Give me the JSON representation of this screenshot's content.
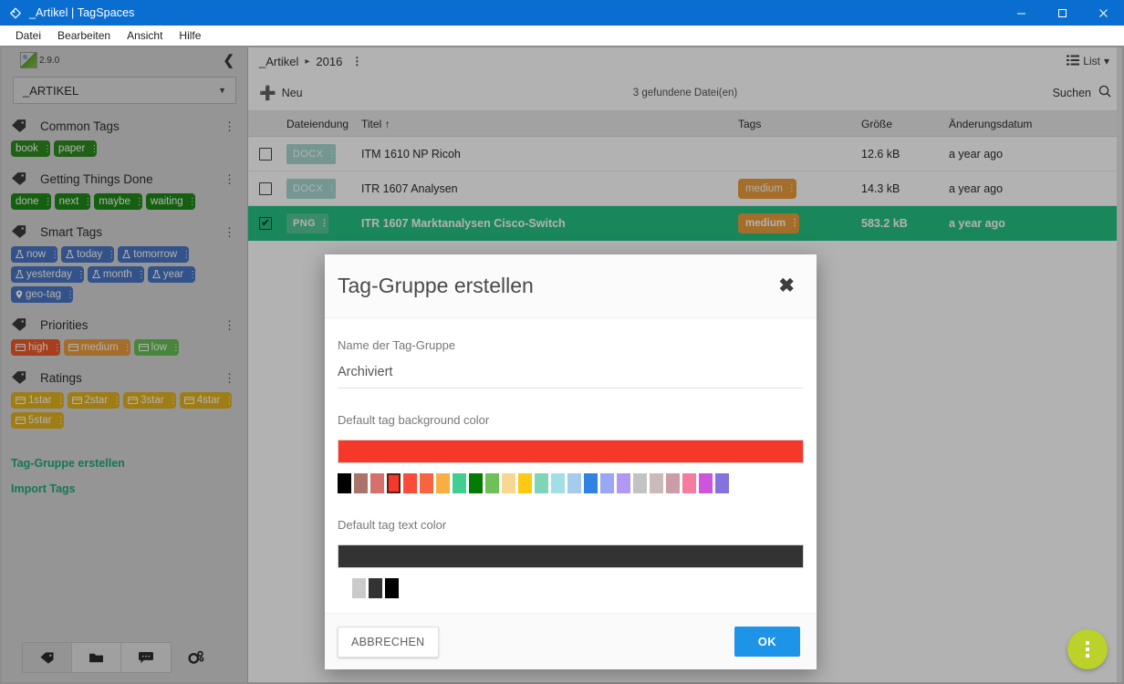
{
  "window": {
    "title": "_Artikel | TagSpaces",
    "app_icon": "tagspaces-icon",
    "controls": {
      "minimize": "minimize-icon",
      "maximize": "maximize-icon",
      "close": "close-icon"
    }
  },
  "menubar": {
    "items": [
      "Datei",
      "Bearbeiten",
      "Ansicht",
      "Hilfe"
    ]
  },
  "sidebar": {
    "version": "2.9.0",
    "collapse_icon": "chevron-left-icon",
    "location": {
      "value": "_ARTIKEL",
      "caret": "chevron-down-icon"
    },
    "groups": [
      {
        "title": "Common Tags",
        "icon": "tag-icon",
        "menu_icon": "more-vertical-icon",
        "tags": [
          {
            "label": "book",
            "bg": "#2f8b1f",
            "fg": "#ffffff",
            "icon": ""
          },
          {
            "label": "paper",
            "bg": "#2f8b1f",
            "fg": "#ffffff",
            "icon": ""
          }
        ]
      },
      {
        "title": "Getting Things Done",
        "icon": "tag-icon",
        "menu_icon": "more-vertical-icon",
        "tags": [
          {
            "label": "done",
            "bg": "#1f8a17",
            "fg": "#ffffff",
            "icon": ""
          },
          {
            "label": "next",
            "bg": "#1f8a17",
            "fg": "#ffffff",
            "icon": ""
          },
          {
            "label": "maybe",
            "bg": "#1f8a17",
            "fg": "#ffffff",
            "icon": ""
          },
          {
            "label": "waiting",
            "bg": "#1f8a17",
            "fg": "#ffffff",
            "icon": ""
          }
        ]
      },
      {
        "title": "Smart Tags",
        "icon": "tag-icon",
        "menu_icon": "more-vertical-icon",
        "tags": [
          {
            "label": "now",
            "bg": "#4a76c4",
            "fg": "#ffffff",
            "icon": "flask-icon"
          },
          {
            "label": "today",
            "bg": "#4a76c4",
            "fg": "#ffffff",
            "icon": "flask-icon"
          },
          {
            "label": "tomorrow",
            "bg": "#4a76c4",
            "fg": "#ffffff",
            "icon": "flask-icon"
          },
          {
            "label": "yesterday",
            "bg": "#4a76c4",
            "fg": "#ffffff",
            "icon": "flask-icon"
          },
          {
            "label": "month",
            "bg": "#4a76c4",
            "fg": "#ffffff",
            "icon": "flask-icon"
          },
          {
            "label": "year",
            "bg": "#4a76c4",
            "fg": "#ffffff",
            "icon": "flask-icon"
          },
          {
            "label": "geo-tag",
            "bg": "#4a76c4",
            "fg": "#ffffff",
            "icon": "map-pin-icon"
          }
        ]
      },
      {
        "title": "Priorities",
        "icon": "tag-icon",
        "menu_icon": "more-vertical-icon",
        "tags": [
          {
            "label": "high",
            "bg": "#f15a29",
            "fg": "#ffffff",
            "icon": "card-icon"
          },
          {
            "label": "medium",
            "bg": "#eb9d3c",
            "fg": "#ffffff",
            "icon": "card-icon"
          },
          {
            "label": "low",
            "bg": "#66c155",
            "fg": "#ffffff",
            "icon": "card-icon"
          }
        ]
      },
      {
        "title": "Ratings",
        "icon": "tag-icon",
        "menu_icon": "more-vertical-icon",
        "tags": [
          {
            "label": "1star",
            "bg": "#e3b322",
            "fg": "#ffffff",
            "icon": "card-icon"
          },
          {
            "label": "2star",
            "bg": "#e3b322",
            "fg": "#ffffff",
            "icon": "card-icon"
          },
          {
            "label": "3star",
            "bg": "#e3b322",
            "fg": "#ffffff",
            "icon": "card-icon"
          },
          {
            "label": "4star",
            "bg": "#e3b322",
            "fg": "#ffffff",
            "icon": "card-icon"
          },
          {
            "label": "5star",
            "bg": "#e3b322",
            "fg": "#ffffff",
            "icon": "card-icon"
          }
        ]
      }
    ],
    "links": [
      {
        "label": "Tag-Gruppe erstellen",
        "color": "#1ea97c"
      },
      {
        "label": "Import Tags",
        "color": "#1ea97c"
      }
    ],
    "bottom_buttons": [
      {
        "icon": "tag-icon",
        "active": true
      },
      {
        "icon": "folder-icon",
        "active": false
      },
      {
        "icon": "chat-icon",
        "active": false
      }
    ],
    "settings_icon": "gear-icon"
  },
  "main": {
    "breadcrumb": {
      "root": "_Artikel",
      "separator": "▸",
      "current": "2016",
      "info_icon": "info-icon"
    },
    "view_switch": {
      "icon": "list-icon",
      "label": "List",
      "caret": "▾"
    },
    "toolbar": {
      "new_label": "Neu",
      "new_icon": "plus-icon",
      "found_count": "3 gefundene Datei(en)",
      "search_label": "Suchen",
      "search_icon": "search-icon"
    },
    "columns": {
      "extension": "Dateiendung",
      "title": "Titel",
      "title_sort": "↑",
      "tags": "Tags",
      "size": "Größe",
      "date": "Änderungsdatum"
    },
    "rows": [
      {
        "checked": false,
        "ext": "DOCX",
        "title": "ITM 1610 NP Ricoh",
        "tags": [],
        "size": "12.6 kB",
        "date": "a year ago",
        "selected": false
      },
      {
        "checked": false,
        "ext": "DOCX",
        "title": "ITR 1607 Analysen",
        "tags": [
          {
            "label": "medium",
            "bg": "#eb9d3c",
            "fg": "#ffffff"
          }
        ],
        "size": "14.3 kB",
        "date": "a year ago",
        "selected": false
      },
      {
        "checked": true,
        "ext": "PNG",
        "title": "ITR 1607 Marktanalysen Cisco-Switch",
        "tags": [
          {
            "label": "medium",
            "bg": "#eb9d3c",
            "fg": "#ffffff"
          }
        ],
        "size": "583.2 kB",
        "date": "a year ago",
        "selected": true
      }
    ],
    "fab": {
      "icon": "more-vertical-icon",
      "color": "#bcd12a"
    }
  },
  "modal": {
    "title": "Tag-Gruppe erstellen",
    "close_icon": "close-icon",
    "name_label": "Name der Tag-Gruppe",
    "name_value": "Archiviert",
    "name_placeholder": "Name der Tag-Gruppe",
    "bg_label": "Default tag background color",
    "bg_selected": "#f6382b",
    "bg_swatches": [
      "#000000",
      "#a9756a",
      "#d5706c",
      "#f6382b",
      "#fb4c3b",
      "#f7643f",
      "#f9ae44",
      "#40cf91",
      "#027b02",
      "#6dc158",
      "#f6d794",
      "#fdc913",
      "#7ed5b8",
      "#a1dfe4",
      "#a5ccec",
      "#3083e0",
      "#9aa7f2",
      "#b198f4",
      "#c3c3c3",
      "#cbbbb8",
      "#cb9ea7",
      "#f57ba0",
      "#cc55dc",
      "#8672de"
    ],
    "bg_selected_index": 3,
    "text_label": "Default tag text color",
    "text_selected": "#333333",
    "text_swatches": [
      "#cacaca",
      "#333333",
      "#000000"
    ],
    "text_selected_index": 1,
    "cancel_label": "ABBRECHEN",
    "ok_label": "OK",
    "ok_color": "#1e94e8"
  }
}
